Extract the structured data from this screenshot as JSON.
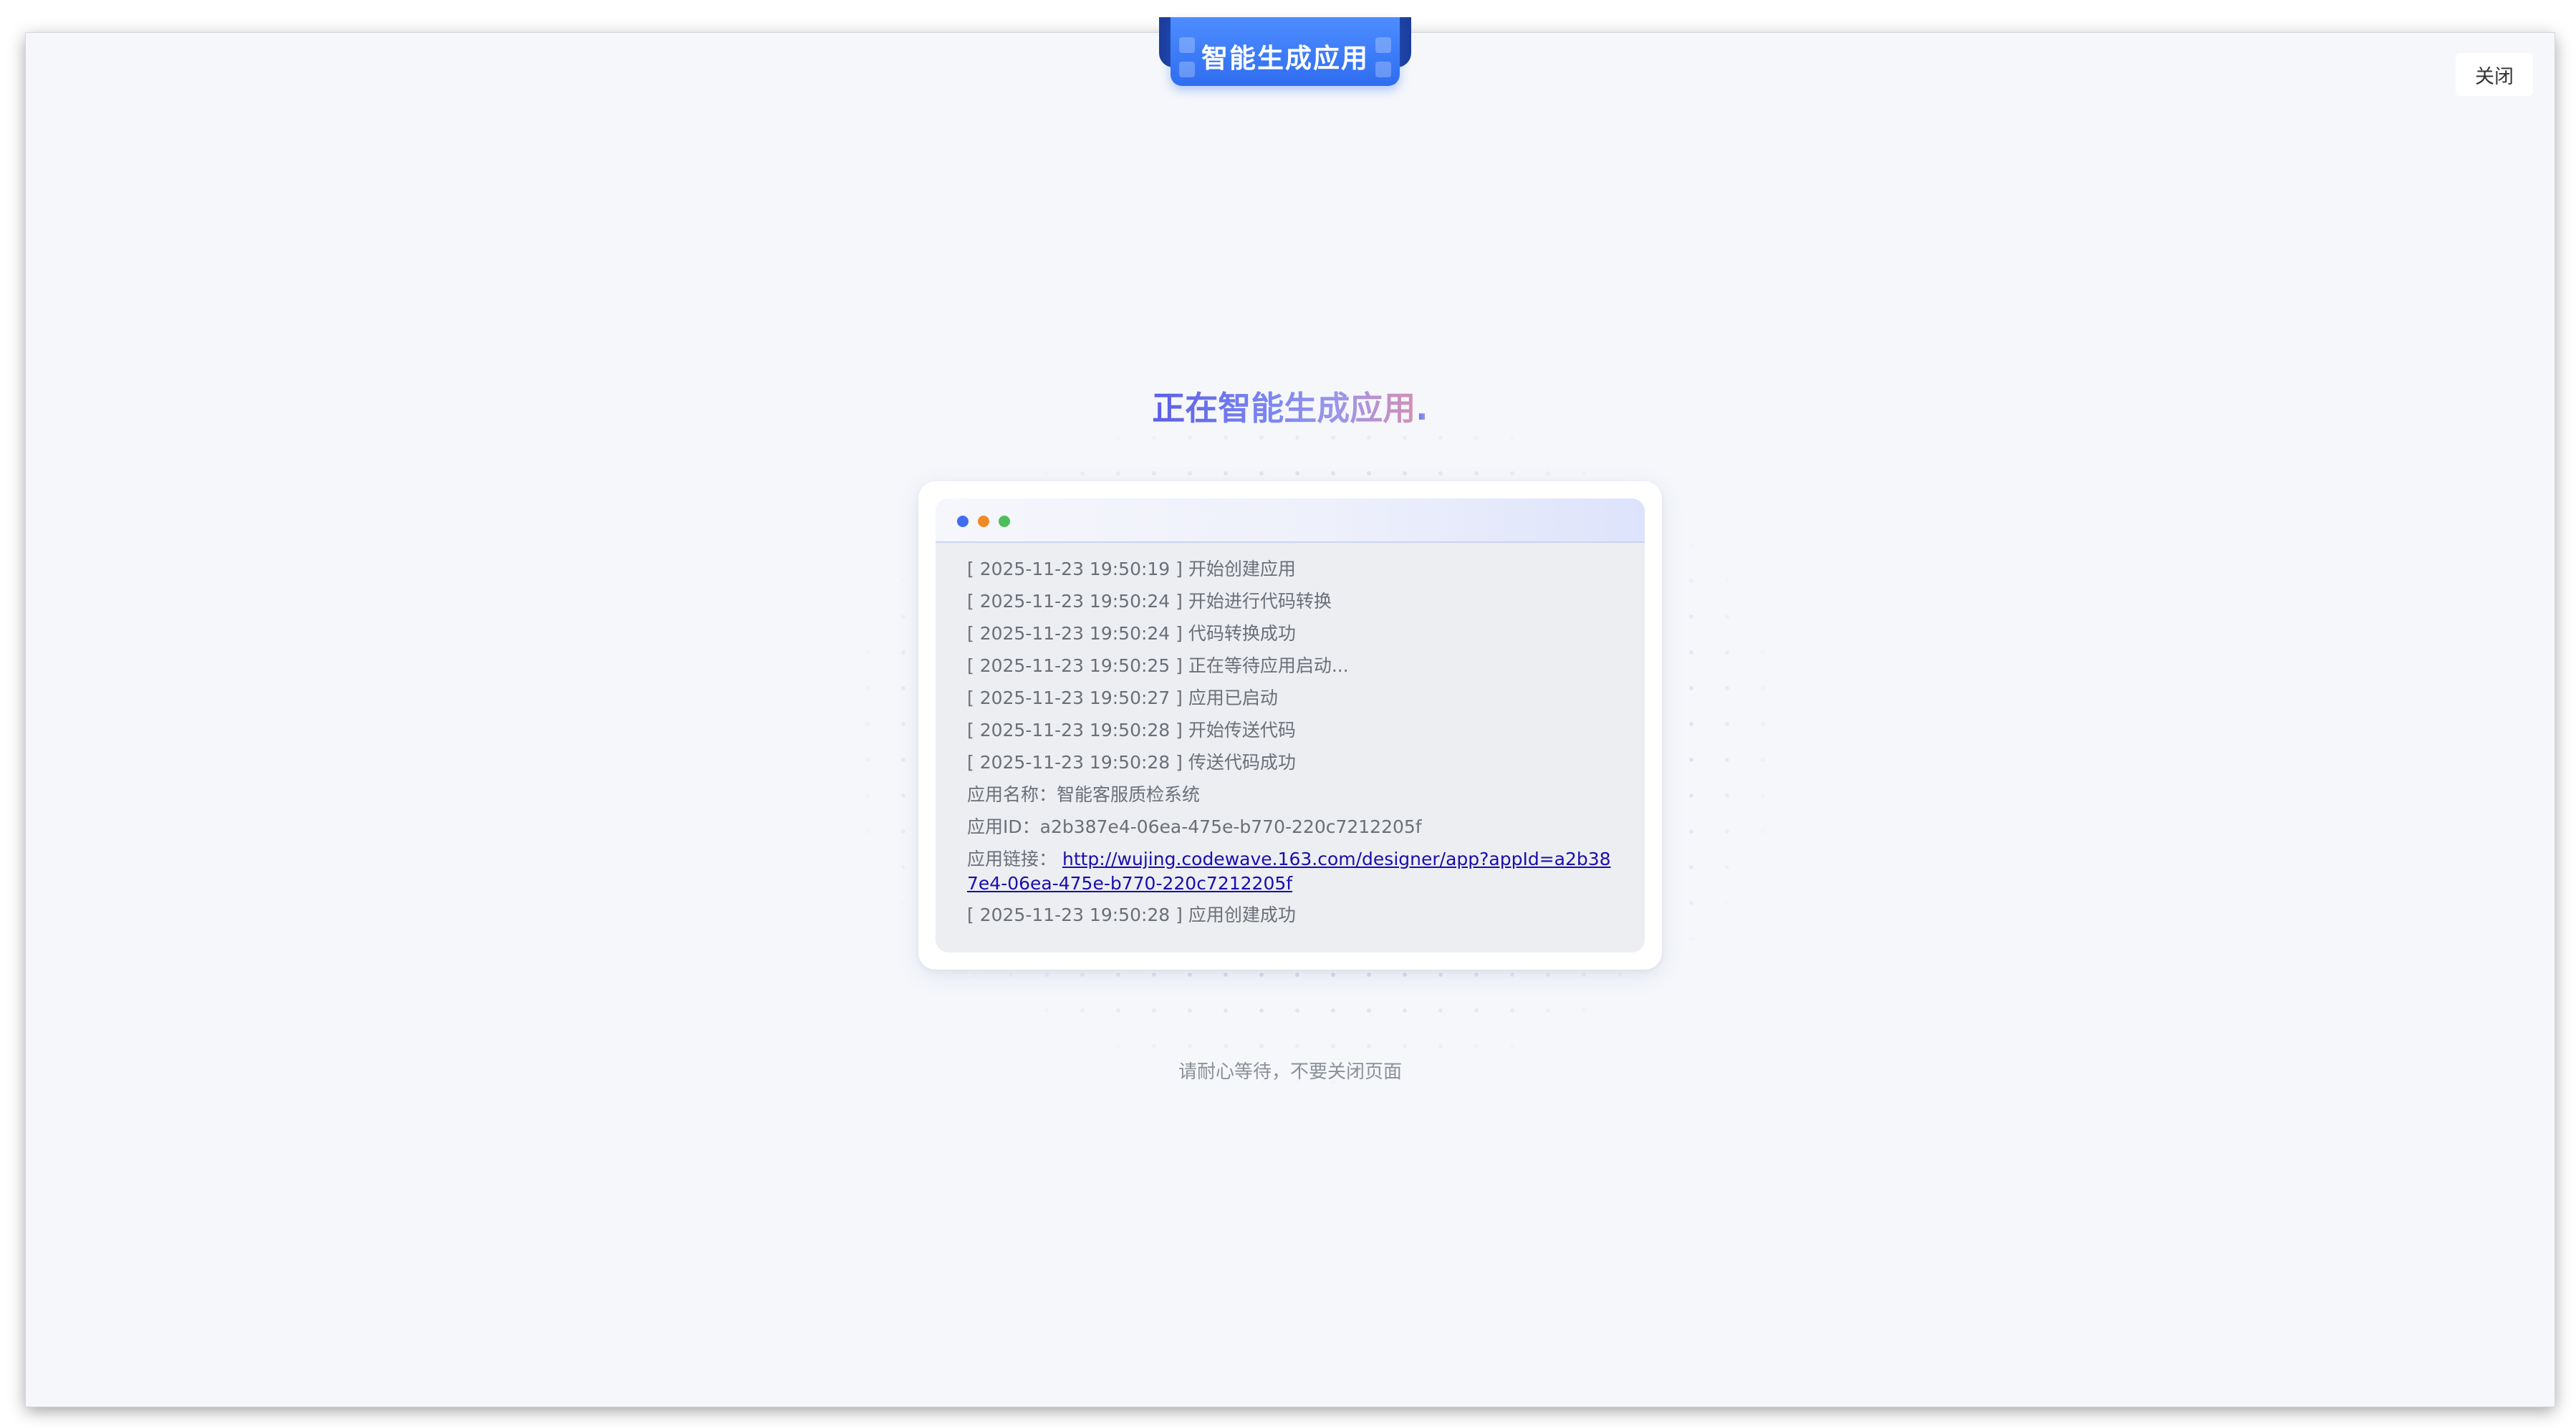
{
  "header": {
    "title": "智能生成应用",
    "close_label": "关闭"
  },
  "main": {
    "heading": "正在智能生成应用",
    "heading_suffix": "."
  },
  "log": {
    "window_dot_colors": [
      "#3e6ff2",
      "#f08a24",
      "#4cbf5a"
    ],
    "lines": [
      "[ 2025-11-23 19:50:19 ] 开始创建应用",
      "[ 2025-11-23 19:50:24 ] 开始进行代码转换",
      "[ 2025-11-23 19:50:24 ] 代码转换成功",
      "[ 2025-11-23 19:50:25 ] 正在等待应用启动...",
      "[ 2025-11-23 19:50:27 ] 应用已启动",
      "[ 2025-11-23 19:50:28 ] 开始传送代码",
      "[ 2025-11-23 19:50:28 ] 传送代码成功",
      "应用名称：智能客服质检系统",
      "应用ID：a2b387e4-06ea-475e-b770-220c7212205f"
    ],
    "link_label": "应用链接：",
    "link_url": "http://wujing.codewave.163.com/designer/app?appId=a2b387e4-06ea-475e-b770-220c7212205f",
    "final_line": "[ 2025-11-23 19:50:28 ] 应用创建成功"
  },
  "footer": {
    "note": "请耐心等待，不要关闭页面"
  }
}
